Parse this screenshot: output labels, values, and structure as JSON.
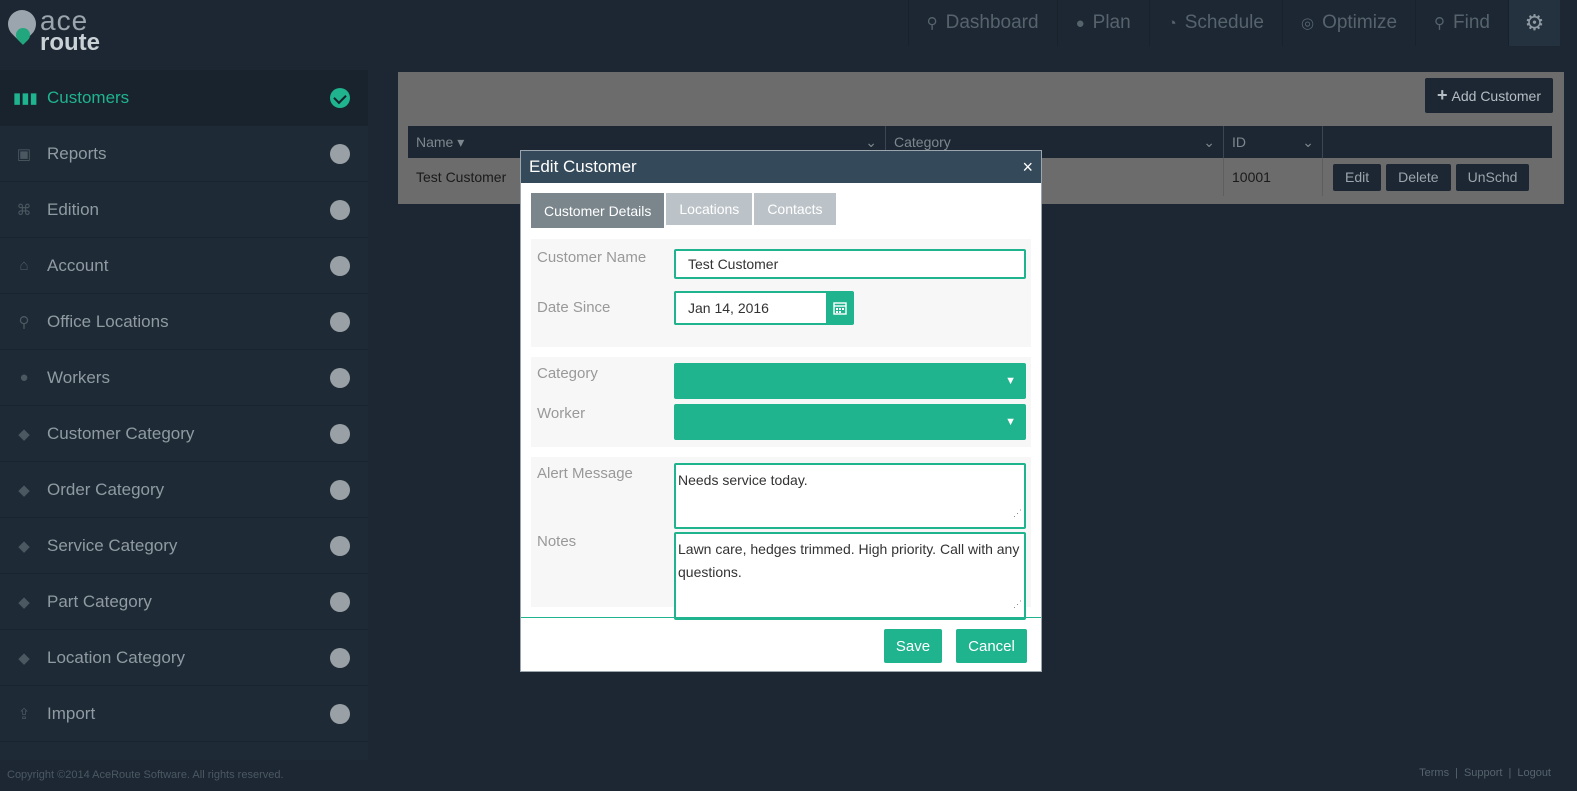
{
  "app": {
    "logo_top": "ace",
    "logo_bottom": "route"
  },
  "nav": [
    {
      "label": "Dashboard",
      "icon": "map-pin-icon"
    },
    {
      "label": "Plan",
      "icon": "person-icon"
    },
    {
      "label": "Schedule",
      "icon": "clock-icon"
    },
    {
      "label": "Optimize",
      "icon": "target-icon"
    },
    {
      "label": "Find",
      "icon": "search-icon"
    }
  ],
  "sidebar": {
    "items": [
      {
        "label": "Customers",
        "icon": "users-icon",
        "active": true
      },
      {
        "label": "Reports",
        "icon": "reports-icon"
      },
      {
        "label": "Edition",
        "icon": "command-icon"
      },
      {
        "label": "Account",
        "icon": "home-icon"
      },
      {
        "label": "Office Locations",
        "icon": "map-pin-icon"
      },
      {
        "label": "Workers",
        "icon": "person-icon"
      },
      {
        "label": "Customer Category",
        "icon": "tag-icon"
      },
      {
        "label": "Order Category",
        "icon": "tag-icon"
      },
      {
        "label": "Service Category",
        "icon": "tag-icon"
      },
      {
        "label": "Part Category",
        "icon": "tag-icon"
      },
      {
        "label": "Location Category",
        "icon": "tag-icon"
      },
      {
        "label": "Import",
        "icon": "import-icon"
      }
    ]
  },
  "grid": {
    "add_button": "Add Customer",
    "columns": [
      "Name ▾",
      "Category",
      "ID"
    ],
    "rows": [
      {
        "name": "Test Customer",
        "category": "",
        "id": "10001"
      }
    ],
    "row_actions": [
      "Edit",
      "Delete",
      "UnSchd"
    ]
  },
  "modal": {
    "title": "Edit Customer",
    "close": "×",
    "tabs": [
      "Customer Details",
      "Locations",
      "Contacts"
    ],
    "fields": {
      "customer_name_label": "Customer Name",
      "customer_name_value": "Test Customer",
      "date_since_label": "Date Since",
      "date_since_value": "Jan 14, 2016",
      "category_label": "Category",
      "worker_label": "Worker",
      "alert_label": "Alert Message",
      "alert_value": "Needs service today.",
      "notes_label": "Notes",
      "notes_value": "Lawn care, hedges trimmed.  High priority. Call with any questions."
    },
    "save": "Save",
    "cancel": "Cancel"
  },
  "footer": {
    "copyright": "Copyright ©2014 AceRoute Software. All rights reserved.",
    "links": [
      "Terms",
      "Support",
      "Logout"
    ]
  },
  "colors": {
    "accent": "#1fb38e",
    "dark": "#1c2733",
    "modal_header": "#34495a"
  }
}
